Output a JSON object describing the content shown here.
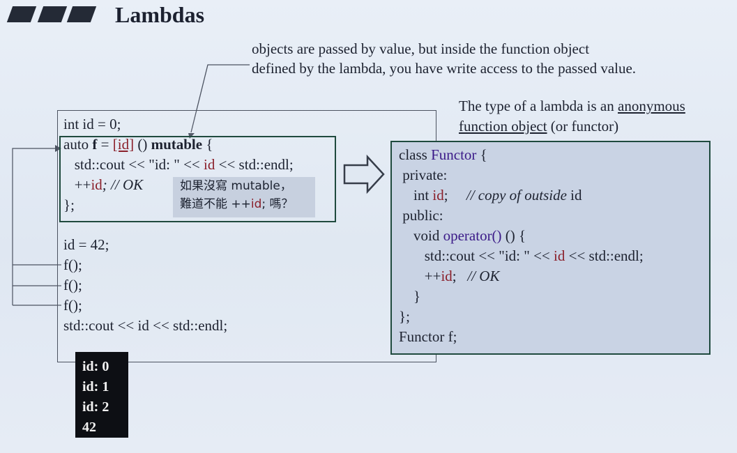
{
  "slide": {
    "title": "Lambdas",
    "note_line1": "objects are passed by value, but inside the function object",
    "note_line2": "defined by the lambda, you have write access to the passed value."
  },
  "left_code": {
    "line1": "int id = 0;",
    "lambda_line1_a": "auto ",
    "lambda_line1_f": "f",
    "lambda_line1_eq": " = ",
    "lambda_line1_capture": "[id]",
    "lambda_line1_paren": " () ",
    "lambda_line1_mutable": "mutable",
    "lambda_line1_brace": " {",
    "lambda_line2_a": "   std::cout << \"id: \" << ",
    "lambda_line2_id": "id",
    "lambda_line2_b": " << std::endl;",
    "lambda_line3_a": "   ++",
    "lambda_line3_id": "id",
    "lambda_line3_comment": "; // OK",
    "lambda_line4": "};",
    "assign": "id = 42;",
    "call1": "f();",
    "call2": "f();",
    "call3": "f();",
    "print": "std::cout << id << std::endl;"
  },
  "annotation": {
    "line1": "如果沒寫 mutable，",
    "line2_a": "難道不能 ++",
    "line2_id": "id",
    "line2_b": "; 嗎？"
  },
  "right_caption": {
    "line1_a": "The type of a lambda is an ",
    "line1_u": "anonymous",
    "line2_u": "function object",
    "line2_b": " (or functor)"
  },
  "functor_code": {
    "l1_a": "class ",
    "l1_name": "Functor",
    "l1_b": " {",
    "l2": " private:",
    "l3_a": "    int ",
    "l3_id": "id",
    "l3_b": ";     ",
    "l3_comment": "// copy of outside",
    "l3_c": " id",
    "l4": " public:",
    "l5_a": "    void ",
    "l5_op": "operator()",
    "l5_b": " () {",
    "l6_a": "       std::cout << \"id: \" << ",
    "l6_id": "id",
    "l6_b": " << std::endl;",
    "l7_a": "       ++",
    "l7_id": "id",
    "l7_b": ";   ",
    "l7_comment": "// OK",
    "l8": "    }",
    "l9": "};",
    "l10": "Functor f;"
  },
  "output": {
    "lines": [
      "id: 0",
      "id: 1",
      "id: 2",
      "42"
    ]
  },
  "colors": {
    "background": "#e4ebf5",
    "box_border": "#1f4a3e",
    "identifier_red": "#8a1f2a",
    "functor_purple": "#3b1a88",
    "output_bg": "#0d0f14"
  }
}
